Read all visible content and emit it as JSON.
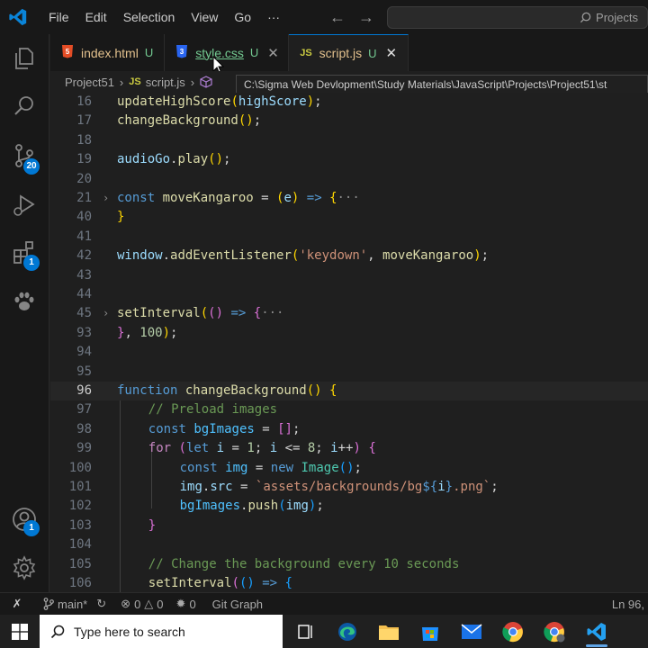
{
  "menu": [
    "File",
    "Edit",
    "Selection",
    "View",
    "Go",
    "···"
  ],
  "search": {
    "label": "Projects"
  },
  "tabs": [
    {
      "icon": "html5-icon",
      "name": "index.html",
      "status": "U"
    },
    {
      "icon": "css3-icon",
      "name": "style.css",
      "status": "U"
    },
    {
      "icon": "js-icon",
      "name": "script.js",
      "status": "U"
    }
  ],
  "breadcrumb": {
    "folder": "Project51",
    "file": "script.js",
    "js_label": "JS"
  },
  "tooltip": "C:\\Sigma Web Devlopment\\Study Materials\\JavaScript\\Projects\\Project51\\st",
  "badges": {
    "source_control": "20",
    "extensions": "1",
    "accounts": "1"
  },
  "code_lines": [
    {
      "n": "16",
      "segs": [
        [
          "f",
          "updateHighScore"
        ],
        [
          "br1",
          "("
        ],
        [
          "v",
          "highScore"
        ],
        [
          "br1",
          ")"
        ],
        [
          "p",
          ";"
        ]
      ]
    },
    {
      "n": "17",
      "segs": [
        [
          "f",
          "changeBackground"
        ],
        [
          "br1",
          "("
        ],
        [
          "br1",
          ")"
        ],
        [
          "p",
          ";"
        ]
      ]
    },
    {
      "n": "18",
      "segs": []
    },
    {
      "n": "19",
      "segs": [
        [
          "v",
          "audioGo"
        ],
        [
          "p",
          "."
        ],
        [
          "f",
          "play"
        ],
        [
          "br1",
          "("
        ],
        [
          "br1",
          ")"
        ],
        [
          "p",
          ";"
        ]
      ]
    },
    {
      "n": "20",
      "segs": []
    },
    {
      "n": "21",
      "fold": true,
      "segs": [
        [
          "k",
          "const "
        ],
        [
          "f",
          "moveKangaroo"
        ],
        [
          "p",
          " = "
        ],
        [
          "br1",
          "("
        ],
        [
          "v",
          "e"
        ],
        [
          "br1",
          ")"
        ],
        [
          "k",
          " => "
        ],
        [
          "br1",
          "{"
        ],
        [
          "dots",
          "···"
        ]
      ]
    },
    {
      "n": "40",
      "segs": [
        [
          "br1",
          "}"
        ]
      ]
    },
    {
      "n": "41",
      "segs": []
    },
    {
      "n": "42",
      "segs": [
        [
          "v",
          "window"
        ],
        [
          "p",
          "."
        ],
        [
          "f",
          "addEventListener"
        ],
        [
          "br1",
          "("
        ],
        [
          "s",
          "'keydown'"
        ],
        [
          "p",
          ", "
        ],
        [
          "f",
          "moveKangaroo"
        ],
        [
          "br1",
          ")"
        ],
        [
          "p",
          ";"
        ]
      ]
    },
    {
      "n": "43",
      "segs": []
    },
    {
      "n": "44",
      "segs": []
    },
    {
      "n": "45",
      "fold": true,
      "segs": [
        [
          "f",
          "setInterval"
        ],
        [
          "br1",
          "("
        ],
        [
          "br2",
          "("
        ],
        [
          "br2",
          ")"
        ],
        [
          "k",
          " => "
        ],
        [
          "br2",
          "{"
        ],
        [
          "dots",
          "···"
        ]
      ]
    },
    {
      "n": "93",
      "segs": [
        [
          "br2",
          "}"
        ],
        [
          "p",
          ", "
        ],
        [
          "n",
          "100"
        ],
        [
          "br1",
          ")"
        ],
        [
          "p",
          ";"
        ]
      ]
    },
    {
      "n": "94",
      "segs": []
    },
    {
      "n": "95",
      "segs": []
    },
    {
      "n": "96",
      "current": true,
      "segs": [
        [
          "k",
          "function "
        ],
        [
          "f",
          "changeBackground"
        ],
        [
          "br1",
          "("
        ],
        [
          "br1",
          ")"
        ],
        [
          "p",
          " "
        ],
        [
          "br1",
          "{"
        ]
      ]
    },
    {
      "n": "97",
      "indent": 1,
      "segs": [
        [
          "cm",
          "// Preload images"
        ]
      ]
    },
    {
      "n": "98",
      "indent": 1,
      "segs": [
        [
          "k",
          "const "
        ],
        [
          "c",
          "bgImages"
        ],
        [
          "p",
          " = "
        ],
        [
          "br2",
          "["
        ],
        [
          "br2",
          "]"
        ],
        [
          "p",
          ";"
        ]
      ]
    },
    {
      "n": "99",
      "indent": 1,
      "segs": [
        [
          "kw",
          "for "
        ],
        [
          "br2",
          "("
        ],
        [
          "k",
          "let "
        ],
        [
          "v",
          "i"
        ],
        [
          "p",
          " = "
        ],
        [
          "n",
          "1"
        ],
        [
          "p",
          "; "
        ],
        [
          "v",
          "i"
        ],
        [
          "p",
          " <= "
        ],
        [
          "n",
          "8"
        ],
        [
          "p",
          "; "
        ],
        [
          "v",
          "i"
        ],
        [
          "p",
          "++"
        ],
        [
          "br2",
          ")"
        ],
        [
          "p",
          " "
        ],
        [
          "br2",
          "{"
        ]
      ]
    },
    {
      "n": "100",
      "indent": 2,
      "segs": [
        [
          "k",
          "const "
        ],
        [
          "c",
          "img"
        ],
        [
          "p",
          " = "
        ],
        [
          "k",
          "new "
        ],
        [
          "cl",
          "Image"
        ],
        [
          "br3",
          "("
        ],
        [
          "br3",
          ")"
        ],
        [
          "p",
          ";"
        ]
      ]
    },
    {
      "n": "101",
      "indent": 2,
      "segs": [
        [
          "v",
          "img"
        ],
        [
          "p",
          "."
        ],
        [
          "v",
          "src"
        ],
        [
          "p",
          " = "
        ],
        [
          "s",
          "`assets/backgrounds/bg"
        ],
        [
          "k",
          "${"
        ],
        [
          "v",
          "i"
        ],
        [
          "k",
          "}"
        ],
        [
          "s",
          ".png`"
        ],
        [
          "p",
          ";"
        ]
      ]
    },
    {
      "n": "102",
      "indent": 2,
      "segs": [
        [
          "c",
          "bgImages"
        ],
        [
          "p",
          "."
        ],
        [
          "f",
          "push"
        ],
        [
          "br3",
          "("
        ],
        [
          "v",
          "img"
        ],
        [
          "br3",
          ")"
        ],
        [
          "p",
          ";"
        ]
      ]
    },
    {
      "n": "103",
      "indent": 1,
      "segs": [
        [
          "br2",
          "}"
        ]
      ]
    },
    {
      "n": "104",
      "segs": []
    },
    {
      "n": "105",
      "indent": 1,
      "segs": [
        [
          "cm",
          "// Change the background every 10 seconds"
        ]
      ]
    },
    {
      "n": "106",
      "indent": 1,
      "segs": [
        [
          "f",
          "setInterval"
        ],
        [
          "br2",
          "("
        ],
        [
          "br3",
          "("
        ],
        [
          "br3",
          ")"
        ],
        [
          "k",
          " => "
        ],
        [
          "br3",
          "{"
        ]
      ]
    }
  ],
  "statusbar": {
    "branch": "main*",
    "errors": "0",
    "warnings": "0",
    "ports": "0",
    "git_graph": "Git Graph",
    "position": "Ln 96,"
  },
  "taskbar": {
    "search_placeholder": "Type here to search"
  },
  "colors": {
    "accent": "#0078d4",
    "modified": "#73c991"
  }
}
